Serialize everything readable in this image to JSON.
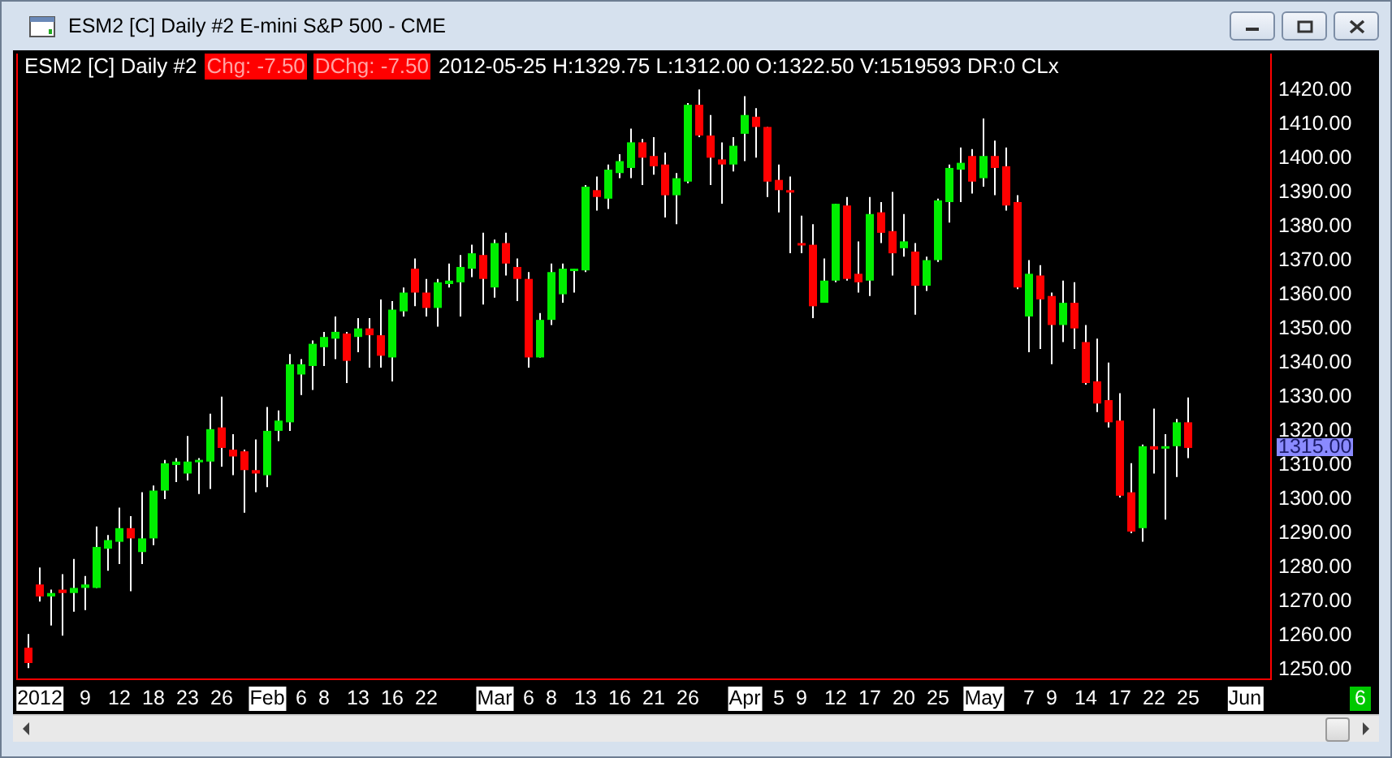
{
  "window": {
    "title": "ESM2 [C]  Daily  #2  E-mini S&P 500 - CME"
  },
  "header": [
    {
      "text": "ESM2 [C]  Daily  #2",
      "highlighted": false
    },
    {
      "text": "Chg: -7.50",
      "highlighted": true
    },
    {
      "text": "DChg: -7.50",
      "highlighted": true
    },
    {
      "text": "2012-05-25 H:1329.75 L:1312.00 O:1322.50 V:1519593 DR:0 CLx",
      "highlighted": false
    }
  ],
  "price_marker": "1315.00",
  "corner_badge": "6",
  "date_axis": [
    {
      "highlighted": true
    },
    {
      "highlighted": false
    },
    {
      "highlighted": false
    },
    {
      "highlighted": false
    },
    {
      "highlighted": false
    },
    {
      "highlighted": false
    },
    {
      "highlighted": true
    },
    {
      "highlighted": false
    },
    {
      "highlighted": false
    },
    {
      "highlighted": false
    },
    {
      "highlighted": false
    },
    {
      "highlighted": false
    },
    {
      "highlighted": true
    },
    {
      "highlighted": false
    },
    {
      "highlighted": false
    },
    {
      "highlighted": false
    },
    {
      "highlighted": false
    },
    {
      "highlighted": false
    },
    {
      "highlighted": false
    },
    {
      "highlighted": true
    },
    {
      "highlighted": false
    },
    {
      "highlighted": false
    },
    {
      "highlighted": false
    },
    {
      "highlighted": false
    },
    {
      "highlighted": false
    },
    {
      "highlighted": false
    },
    {
      "highlighted": true
    },
    {
      "highlighted": false
    },
    {
      "highlighted": false
    },
    {
      "highlighted": false
    },
    {
      "highlighted": false
    },
    {
      "highlighted": false
    },
    {
      "highlighted": false
    },
    {
      "highlighted": true
    }
  ],
  "chart_data": {
    "type": "candlestick",
    "ylim": [
      1247,
      1430.5
    ],
    "yticks": [
      {
        "value": 1250,
        "label": "1250.00"
      },
      {
        "value": 1260,
        "label": "1260.00"
      },
      {
        "value": 1270,
        "label": "1270.00"
      },
      {
        "value": 1280,
        "label": "1280.00"
      },
      {
        "value": 1290,
        "label": "1290.00"
      },
      {
        "value": 1300,
        "label": "1300.00"
      },
      {
        "value": 1310,
        "label": "1310.00"
      },
      {
        "value": 1320,
        "label": "1320.00"
      },
      {
        "value": 1330,
        "label": "1330.00"
      },
      {
        "value": 1340,
        "label": "1340.00"
      },
      {
        "value": 1350,
        "label": "1350.00"
      },
      {
        "value": 1360,
        "label": "1360.00"
      },
      {
        "value": 1370,
        "label": "1370.00"
      },
      {
        "value": 1380,
        "label": "1380.00"
      },
      {
        "value": 1390,
        "label": "1390.00"
      },
      {
        "value": 1400,
        "label": "1400.00"
      },
      {
        "value": 1410,
        "label": "1410.00"
      },
      {
        "value": 1420,
        "label": "1420.00"
      }
    ],
    "categories": [
      null,
      "2012",
      null,
      null,
      null,
      "9",
      null,
      null,
      "12",
      null,
      null,
      "18",
      null,
      null,
      "23",
      null,
      null,
      "26",
      null,
      null,
      null,
      "Feb",
      null,
      null,
      "6",
      null,
      "8",
      null,
      null,
      "13",
      null,
      null,
      "16",
      null,
      null,
      "22",
      null,
      null,
      null,
      null,
      null,
      "Mar",
      null,
      null,
      "6",
      null,
      "8",
      null,
      null,
      "13",
      null,
      null,
      "16",
      null,
      null,
      "21",
      null,
      null,
      "26",
      null,
      null,
      null,
      null,
      "Apr",
      null,
      null,
      "5",
      null,
      "9",
      null,
      null,
      "12",
      null,
      null,
      "17",
      null,
      null,
      "20",
      null,
      null,
      "25",
      null,
      null,
      null,
      "May",
      null,
      null,
      null,
      "7",
      null,
      "9",
      null,
      null,
      "14",
      null,
      null,
      "17",
      null,
      null,
      "22",
      null,
      null,
      "25",
      null,
      null,
      null,
      null,
      "Jun"
    ],
    "ohlc": [
      [
        1256.5,
        1260.5,
        1250.5,
        1252
      ],
      [
        1275,
        1280,
        1270,
        1271.5
      ],
      [
        1271.5,
        1273.5,
        1263,
        1272.5
      ],
      [
        1273.5,
        1278,
        1260,
        1272.5
      ],
      [
        1272.5,
        1282.5,
        1267,
        1274
      ],
      [
        1274,
        1277.5,
        1267.5,
        1275
      ],
      [
        1274,
        1292,
        1274,
        1286
      ],
      [
        1285.5,
        1289.5,
        1279,
        1288
      ],
      [
        1287.5,
        1297.5,
        1281,
        1291.5
      ],
      [
        1291.5,
        1295,
        1273,
        1288.5
      ],
      [
        1284.5,
        1302,
        1281,
        1288.5
      ],
      [
        1288.5,
        1304,
        1286.5,
        1302.5
      ],
      [
        1302.5,
        1311.5,
        1300,
        1310.5
      ],
      [
        1310,
        1312,
        1305,
        1311
      ],
      [
        1307.5,
        1318.5,
        1305.5,
        1311
      ],
      [
        1311,
        1312,
        1301.5,
        1311.5
      ],
      [
        1311,
        1325,
        1303,
        1320.5
      ],
      [
        1321,
        1330,
        1309.5,
        1315
      ],
      [
        1314.5,
        1319,
        1307,
        1312.5
      ],
      [
        1314,
        1314.5,
        1296,
        1308.5
      ],
      [
        1308.5,
        1317.5,
        1302,
        1307.5
      ],
      [
        1307,
        1327,
        1303.5,
        1320
      ],
      [
        1320,
        1326,
        1317,
        1323
      ],
      [
        1322.5,
        1342.5,
        1320,
        1339.5
      ],
      [
        1336.5,
        1341,
        1330.5,
        1339.5
      ],
      [
        1339,
        1346.5,
        1332,
        1345.5
      ],
      [
        1344.5,
        1349,
        1339,
        1347.5
      ],
      [
        1347,
        1353.5,
        1341,
        1349
      ],
      [
        1348.5,
        1349,
        1334,
        1340.5
      ],
      [
        1347.5,
        1353,
        1343,
        1350
      ],
      [
        1350,
        1353,
        1338.5,
        1348
      ],
      [
        1348,
        1358.5,
        1338.5,
        1342
      ],
      [
        1341.5,
        1358,
        1334.5,
        1355.5
      ],
      [
        1355,
        1362,
        1353.5,
        1360.5
      ],
      [
        1367.5,
        1370.5,
        1356.5,
        1360.5
      ],
      [
        1360.5,
        1364.5,
        1353.5,
        1356
      ],
      [
        1356,
        1364.5,
        1350.5,
        1363.5
      ],
      [
        1363,
        1369,
        1362,
        1364
      ],
      [
        1363.5,
        1371.5,
        1353.5,
        1368
      ],
      [
        1367.5,
        1374.5,
        1365,
        1372
      ],
      [
        1371.5,
        1378,
        1357,
        1364.5
      ],
      [
        1362,
        1376,
        1359,
        1375
      ],
      [
        1375,
        1378,
        1365.5,
        1369
      ],
      [
        1368,
        1370.5,
        1358,
        1364.5
      ],
      [
        1364.5,
        1366.5,
        1338.5,
        1341.5
      ],
      [
        1341.5,
        1354.5,
        1341.5,
        1352.5
      ],
      [
        1352.5,
        1369,
        1351,
        1366.5
      ],
      [
        1360,
        1369,
        1357.5,
        1367.5
      ],
      [
        1367,
        1367.5,
        1360.5,
        1367.5
      ],
      [
        1367,
        1392,
        1366.5,
        1391.5
      ],
      [
        1390.5,
        1394.5,
        1384.5,
        1388.5
      ],
      [
        1388,
        1398,
        1385,
        1396.5
      ],
      [
        1395.5,
        1401,
        1394,
        1399
      ],
      [
        1397,
        1408.5,
        1394,
        1404.5
      ],
      [
        1404.5,
        1405.5,
        1392,
        1400
      ],
      [
        1400.5,
        1406,
        1395,
        1397.5
      ],
      [
        1398,
        1401.5,
        1382.5,
        1389
      ],
      [
        1389,
        1395.5,
        1380.5,
        1394
      ],
      [
        1393,
        1416,
        1392.5,
        1415.5
      ],
      [
        1415.5,
        1420,
        1406,
        1406.5
      ],
      [
        1406.5,
        1412.5,
        1392,
        1400
      ],
      [
        1399.5,
        1404.5,
        1386.5,
        1398
      ],
      [
        1398,
        1406,
        1396,
        1403.5
      ],
      [
        1407,
        1418,
        1399,
        1412.5
      ],
      [
        1412,
        1414.5,
        1400,
        1409
      ],
      [
        1409,
        1409,
        1388.5,
        1393
      ],
      [
        1393.5,
        1398,
        1384,
        1390.5
      ],
      [
        1390.5,
        1394.5,
        1372,
        1390
      ],
      [
        1375,
        1383,
        1372,
        1374.5
      ],
      [
        1374.5,
        1380.5,
        1353,
        1356.5
      ],
      [
        1357.5,
        1370.5,
        1357.5,
        1364
      ],
      [
        1364,
        1386.5,
        1363.5,
        1386.5
      ],
      [
        1386,
        1388.5,
        1364,
        1364.5
      ],
      [
        1366,
        1375.5,
        1360.5,
        1363.5
      ],
      [
        1364,
        1388.5,
        1359.5,
        1383.5
      ],
      [
        1384,
        1387,
        1375,
        1378
      ],
      [
        1378.5,
        1390,
        1365.5,
        1372
      ],
      [
        1373.5,
        1383.5,
        1371,
        1375.5
      ],
      [
        1372.5,
        1375,
        1354,
        1362.5
      ],
      [
        1362.5,
        1371,
        1361,
        1370
      ],
      [
        1370,
        1388,
        1369.5,
        1387.5
      ],
      [
        1387,
        1398,
        1381,
        1397
      ],
      [
        1396.5,
        1403,
        1387,
        1398.5
      ],
      [
        1400.5,
        1402.5,
        1389.5,
        1393
      ],
      [
        1394,
        1411.5,
        1391.5,
        1400.5
      ],
      [
        1400.5,
        1405,
        1389,
        1397
      ],
      [
        1397.5,
        1403,
        1384.5,
        1386
      ],
      [
        1387,
        1389,
        1361.5,
        1362
      ],
      [
        1353.5,
        1370,
        1343,
        1366
      ],
      [
        1365.5,
        1368.5,
        1344,
        1358.5
      ],
      [
        1359.5,
        1360.5,
        1339.5,
        1351
      ],
      [
        1351,
        1364,
        1346,
        1357.5
      ],
      [
        1357.5,
        1363.5,
        1344,
        1350
      ],
      [
        1346,
        1351,
        1333.5,
        1334
      ],
      [
        1334.5,
        1347,
        1325.5,
        1328
      ],
      [
        1329,
        1340,
        1321,
        1322.5
      ],
      [
        1323,
        1331,
        1300.5,
        1301
      ],
      [
        1302,
        1310.5,
        1290,
        1290.5
      ],
      [
        1291.5,
        1316,
        1287.5,
        1315.5
      ],
      [
        1315.5,
        1326.5,
        1307.5,
        1314.5
      ],
      [
        1315,
        1319,
        1294,
        1315.5
      ],
      [
        1315.5,
        1323.5,
        1306.5,
        1322.5
      ],
      [
        1322.5,
        1329.75,
        1312,
        1315
      ],
      null,
      null,
      null,
      null,
      null
    ]
  }
}
